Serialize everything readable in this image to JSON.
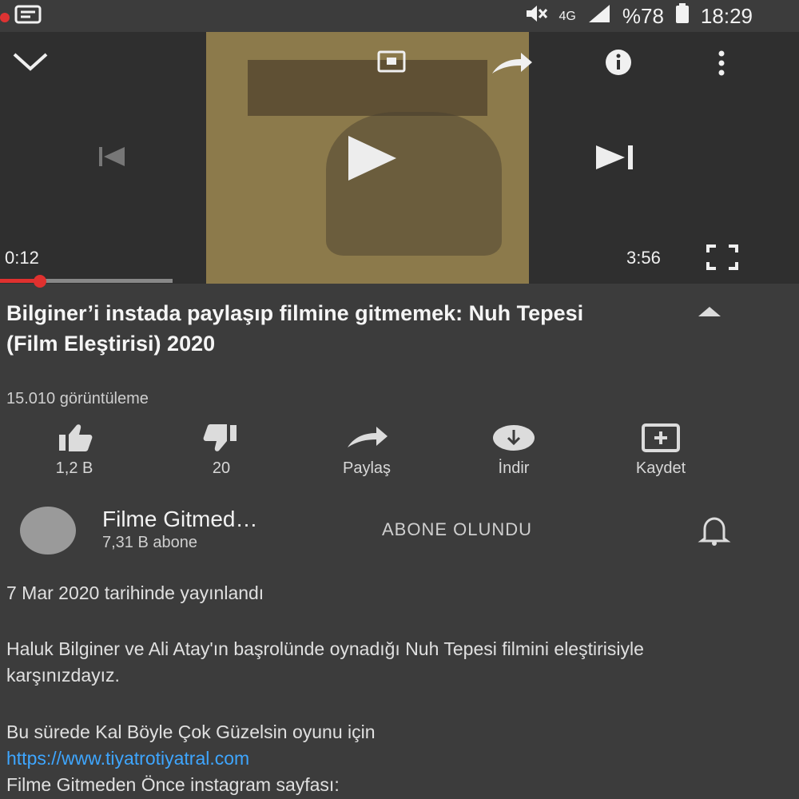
{
  "status_bar": {
    "network": "4G",
    "battery": "%78",
    "time": "18:29"
  },
  "player": {
    "elapsed": "0:12",
    "duration": "3:56",
    "progress_fraction": 0.05
  },
  "video": {
    "title": "Bilginer’i instada paylaşıp filmine gitmemek: Nuh Tepesi (Film Eleştirisi) 2020",
    "views": "15.010 görüntüleme"
  },
  "actions": [
    {
      "name": "like",
      "label": "1,2 B"
    },
    {
      "name": "dislike",
      "label": "20"
    },
    {
      "name": "share",
      "label": "Paylaş"
    },
    {
      "name": "download",
      "label": "İndir"
    },
    {
      "name": "save",
      "label": "Kaydet"
    }
  ],
  "channel": {
    "name": "Filme Gitmed…",
    "subscribers": "7,31 B abone",
    "subscribe_label": "ABONE OLUNDU"
  },
  "description": {
    "date": "7 Mar 2020 tarihinde yayınlandı",
    "paragraph1": "Haluk Bilginer ve Ali Atay'ın başrolünde oynadığı Nuh Tepesi filmini eleştirisiyle karşınızdayız.",
    "paragraph2": "Bu sürede Kal Böyle Çok Güzelsin oyunu için",
    "link": "https://www.tiyatrotiyatral.com",
    "paragraph3": "Filme Gitmeden Önce instagram sayfası:"
  }
}
